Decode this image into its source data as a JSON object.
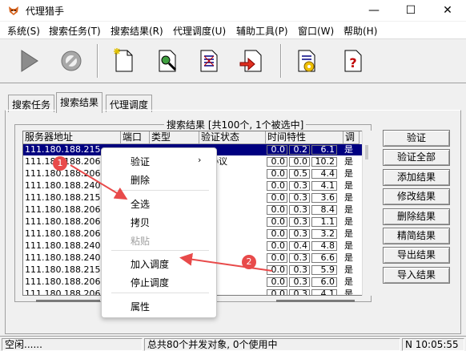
{
  "window": {
    "title": "代理猎手",
    "controls": {
      "minimize": "—",
      "maximize": "☐",
      "close": "✕"
    }
  },
  "menu": [
    "系统(S)",
    "搜索任务(T)",
    "搜索结果(R)",
    "代理调度(U)",
    "辅助工具(P)",
    "窗口(W)",
    "帮助(H)"
  ],
  "toolbar": {
    "icons": [
      "play-icon",
      "stop-icon",
      "new-file-icon",
      "search-document-icon",
      "document-list-icon",
      "import-document-icon",
      "settings-document-icon",
      "help-document-icon"
    ]
  },
  "tabs": [
    "搜索任务",
    "搜索结果",
    "代理调度"
  ],
  "active_tab": "搜索结果",
  "results_group": {
    "title": "搜索结果 [共100个, 1个被选中]"
  },
  "list": {
    "columns": [
      "服务器地址",
      "端口",
      "类型",
      "验证状态",
      "时间特性",
      "调"
    ],
    "rows": [
      {
        "addr": "111.180.188.215",
        "port": "",
        "type": "",
        "status": "",
        "t1": "0.0",
        "t2": "0.2",
        "t3": "6.1",
        "flag": "是",
        "selected": true
      },
      {
        "addr": "111.180.188.206",
        "port": "",
        "type": "",
        "status": "合协议",
        "t1": "0.0",
        "t2": "0.0",
        "t3": "10.2",
        "flag": "是"
      },
      {
        "addr": "111.180.188.206",
        "port": "",
        "type": "",
        "status": "",
        "t1": "0.0",
        "t2": "0.5",
        "t3": "4.4",
        "flag": "是"
      },
      {
        "addr": "111.180.188.240",
        "port": "",
        "type": "",
        "status": "e",
        "t1": "0.0",
        "t2": "0.3",
        "t3": "4.1",
        "flag": "是"
      },
      {
        "addr": "111.180.188.215",
        "port": "",
        "type": "",
        "status": "e",
        "t1": "0.0",
        "t2": "0.3",
        "t3": "3.6",
        "flag": "是"
      },
      {
        "addr": "111.180.188.206",
        "port": "",
        "type": "",
        "status": "e",
        "t1": "0.0",
        "t2": "0.3",
        "t3": "8.4",
        "flag": "是"
      },
      {
        "addr": "111.180.188.206",
        "port": "",
        "type": "",
        "status": "e",
        "t1": "0.0",
        "t2": "0.3",
        "t3": "1.1",
        "flag": "是"
      },
      {
        "addr": "111.180.188.206",
        "port": "",
        "type": "",
        "status": "e",
        "t1": "0.0",
        "t2": "0.3",
        "t3": "3.2",
        "flag": "是"
      },
      {
        "addr": "111.180.188.240",
        "port": "",
        "type": "",
        "status": "e",
        "t1": "0.0",
        "t2": "0.4",
        "t3": "4.8",
        "flag": "是"
      },
      {
        "addr": "111.180.188.240",
        "port": "",
        "type": "",
        "status": "",
        "t1": "0.0",
        "t2": "0.3",
        "t3": "6.6",
        "flag": "是"
      },
      {
        "addr": "111.180.188.215",
        "port": "",
        "type": "",
        "status": "",
        "t1": "0.0",
        "t2": "0.3",
        "t3": "5.9",
        "flag": "是"
      },
      {
        "addr": "111.180.188.206",
        "port": "",
        "type": "",
        "status": "e",
        "t1": "0.0",
        "t2": "0.3",
        "t3": "6.0",
        "flag": "是"
      },
      {
        "addr": "111.180.188.206",
        "port": "",
        "type": "",
        "status": "",
        "t1": "0.0",
        "t2": "0.3",
        "t3": "4.1",
        "flag": "是"
      }
    ]
  },
  "side_buttons": [
    "验证",
    "验证全部",
    "添加结果",
    "修改结果",
    "删除结果",
    "精简结果",
    "导出结果",
    "导入结果"
  ],
  "context_menu": {
    "items": [
      {
        "label": "验证",
        "submenu": true
      },
      {
        "label": "删除"
      },
      {
        "label": "全选"
      },
      {
        "label": "拷贝"
      },
      {
        "label": "粘贴",
        "disabled": true
      },
      {
        "label": "加入调度"
      },
      {
        "label": "停止调度"
      },
      {
        "label": "属性"
      }
    ],
    "submenu_arrow": "›"
  },
  "annotations": {
    "badge1": "1",
    "badge2": "2",
    "color": "#e84a4a"
  },
  "statusbar": {
    "left": "空闲......",
    "middle": "总共80个并发对象, 0个使用中",
    "right": "N 10:05:55"
  }
}
